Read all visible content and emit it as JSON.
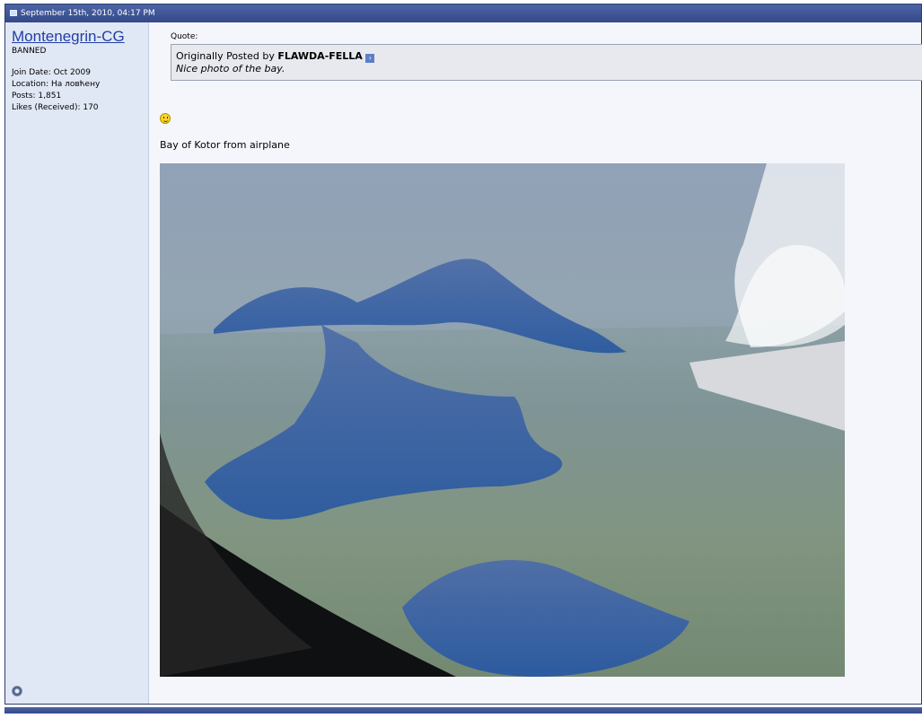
{
  "post": {
    "date": "September 15th, 2010, 04:17 PM"
  },
  "user": {
    "name": "Montenegrin-CG",
    "title": "BANNED",
    "join_date": "Join Date: Oct 2009",
    "location": "Location: На ловћену",
    "posts": "Posts: 1,851",
    "likes": "Likes (Received): 170"
  },
  "quote": {
    "label": "Quote:",
    "posted_by": "Originally Posted by",
    "author": "FLAWDA-FELLA",
    "text": "Nice photo of the bay."
  },
  "message": {
    "text": "Bay of Kotor from airplane"
  },
  "icons": {
    "post": "post-icon",
    "view_post": "view-post-icon",
    "smiley": "smiley-icon",
    "online_status": "online-status-icon"
  },
  "colors": {
    "header": "#35498a",
    "username": "#1f3fa6",
    "sidebar": "#e1e8f5"
  }
}
